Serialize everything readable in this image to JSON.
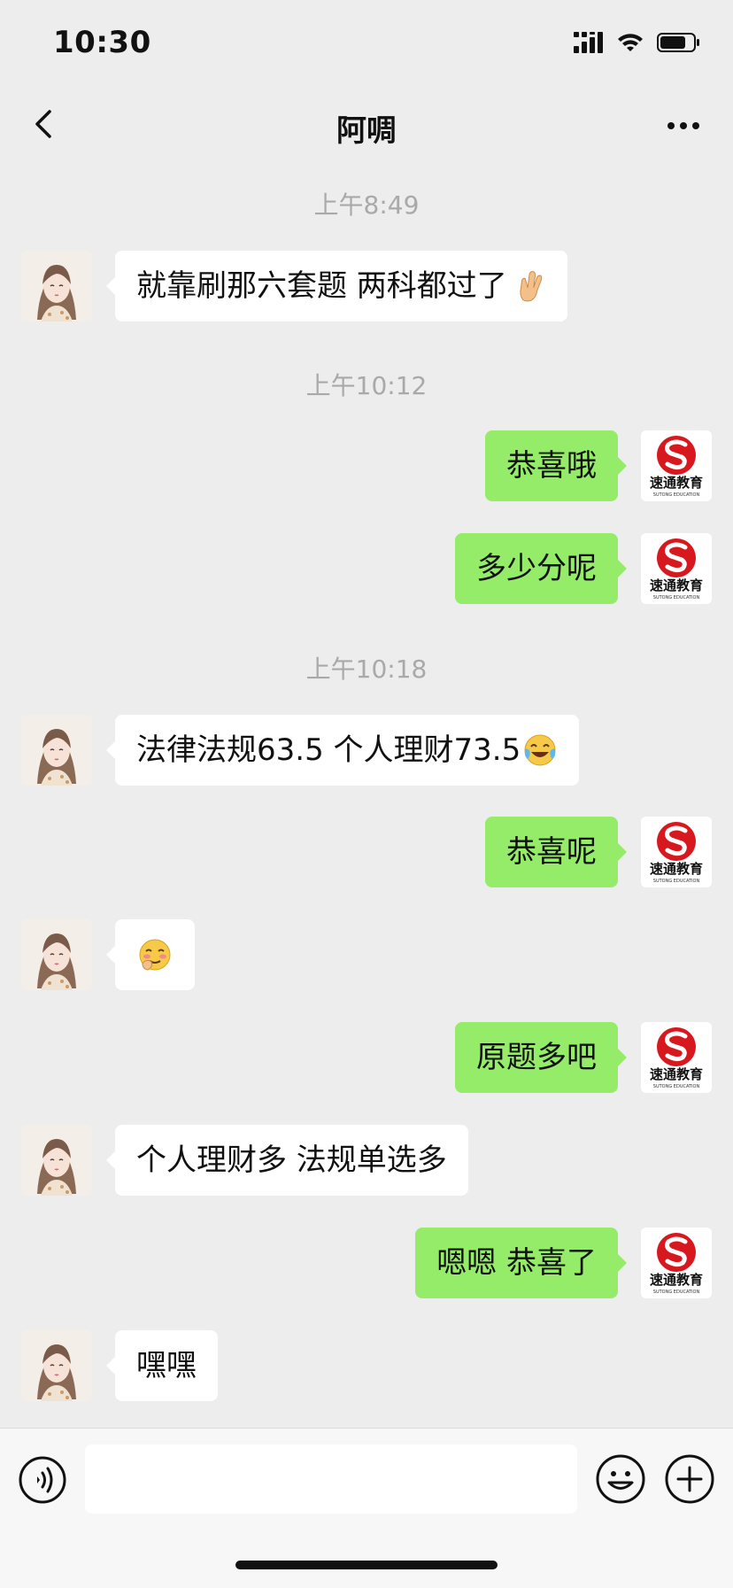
{
  "status_bar": {
    "time": "10:30",
    "icons": [
      "signal-icon",
      "wifi-icon",
      "battery-icon"
    ]
  },
  "nav": {
    "title": "阿啁",
    "back_icon": "chevron-left-icon",
    "more_icon": "more-dots-icon"
  },
  "messages": [
    {
      "kind": "time",
      "text": "上午8:49"
    },
    {
      "kind": "in",
      "text": "就靠刷那六套题 两科都过了",
      "emoji": "victory-hand-emoji"
    },
    {
      "kind": "time",
      "text": "上午10:12"
    },
    {
      "kind": "out",
      "text": "恭喜哦"
    },
    {
      "kind": "out",
      "text": "多少分呢"
    },
    {
      "kind": "time",
      "text": "上午10:18"
    },
    {
      "kind": "in",
      "text": "法律法规63.5 个人理财73.5",
      "emoji": "crying-laughing-emoji"
    },
    {
      "kind": "out",
      "text": "恭喜呢"
    },
    {
      "kind": "in",
      "text": "",
      "emoji": "shy-smile-emoji"
    },
    {
      "kind": "out",
      "text": "原题多吧"
    },
    {
      "kind": "in",
      "text": "个人理财多 法规单选多"
    },
    {
      "kind": "out",
      "text": "嗯嗯 恭喜了"
    },
    {
      "kind": "in",
      "text": "嘿嘿"
    }
  ],
  "avatars": {
    "contact": "girl-avatar",
    "self": {
      "logo_title": "速通教育",
      "logo_subtitle": "SUTONG EDUCATION",
      "logo_color": "#d7191f"
    }
  },
  "input_bar": {
    "voice_icon": "voice-icon",
    "input_placeholder": "",
    "emoji_icon": "smiley-icon",
    "plus_icon": "plus-icon"
  },
  "colors": {
    "background": "#ededed",
    "bubble_out": "#95ec69",
    "bubble_in": "#ffffff",
    "timestamp": "#a9a9a9"
  }
}
